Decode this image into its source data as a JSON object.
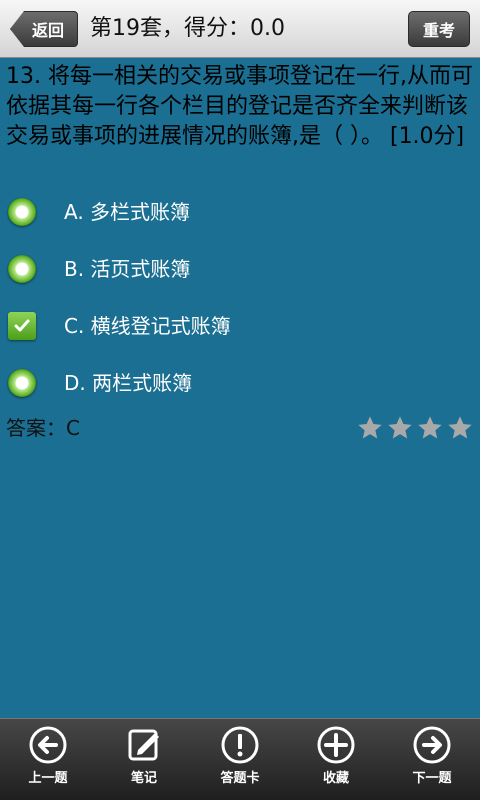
{
  "header": {
    "back_label": "返回",
    "title": "第19套，得分：0.0",
    "retest_label": "重考"
  },
  "question": {
    "text": "13. 将每一相关的交易或事项登记在一行,从而可依据其每一行各个栏目的登记是否齐全来判断该交易或事项的进展情况的账簿,是（     ）。 [1.0分]"
  },
  "options": [
    {
      "label": "A. 多栏式账簿",
      "state": "radio"
    },
    {
      "label": "B. 活页式账簿",
      "state": "radio"
    },
    {
      "label": "C. 横线登记式账簿",
      "state": "checked"
    },
    {
      "label": "D. 两栏式账簿",
      "state": "radio"
    }
  ],
  "answer": {
    "text": "答案：C",
    "rating": 0,
    "rating_max": 4
  },
  "nav": [
    {
      "label": "上一题",
      "icon": "arrow-left-icon"
    },
    {
      "label": "笔记",
      "icon": "note-edit-icon"
    },
    {
      "label": "答题卡",
      "icon": "exclamation-icon"
    },
    {
      "label": "收藏",
      "icon": "plus-icon"
    },
    {
      "label": "下一题",
      "icon": "arrow-right-icon"
    }
  ],
  "colors": {
    "background": "#1a6f92",
    "option_green": "#5cae22",
    "star_gray": "#a9a9a9"
  }
}
